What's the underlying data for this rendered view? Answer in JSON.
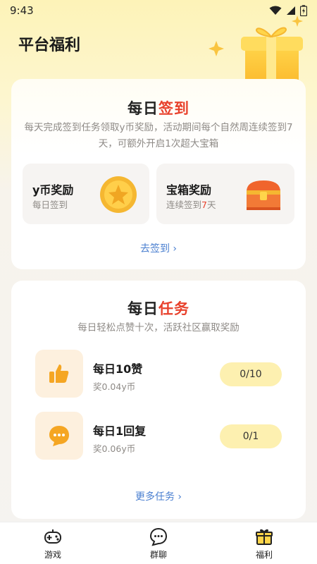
{
  "status_bar": {
    "time": "9:43"
  },
  "page_title": "平台福利",
  "signin": {
    "title_plain": "每日",
    "title_accent": "签到",
    "description": "每天完成签到任务领取y币奖励，活动期间每个自然周连续签到7天，可额外开启1次超大宝箱",
    "rewards": [
      {
        "title": "y币奖励",
        "subtitle": "每日签到",
        "icon": "coin-star-icon"
      },
      {
        "title": "宝箱奖励",
        "subtitle_prefix": "连续签到",
        "subtitle_number": "7",
        "subtitle_suffix": "天",
        "icon": "treasure-chest-icon"
      }
    ],
    "link_label": "去签到 ›"
  },
  "tasks": {
    "title_plain": "每日",
    "title_accent": "任务",
    "description": "每日轻松点赞十次，活跃社区赢取奖励",
    "items": [
      {
        "name": "每日10赞",
        "reward": "奖0.04y币",
        "progress": "0/10",
        "icon": "thumbs-up-icon"
      },
      {
        "name": "每日1回复",
        "reward": "奖0.06y币",
        "progress": "0/1",
        "icon": "chat-bubble-icon"
      }
    ],
    "more_label": "更多任务 ›"
  },
  "tab_bar": {
    "tabs": [
      {
        "label": "游戏",
        "icon": "gamepad-icon"
      },
      {
        "label": "群聊",
        "icon": "chat-icon"
      },
      {
        "label": "福利",
        "icon": "gift-icon"
      }
    ]
  },
  "colors": {
    "accent_red": "#e8412c",
    "link_blue": "#4a7fd0",
    "gold": "#f5b731"
  }
}
